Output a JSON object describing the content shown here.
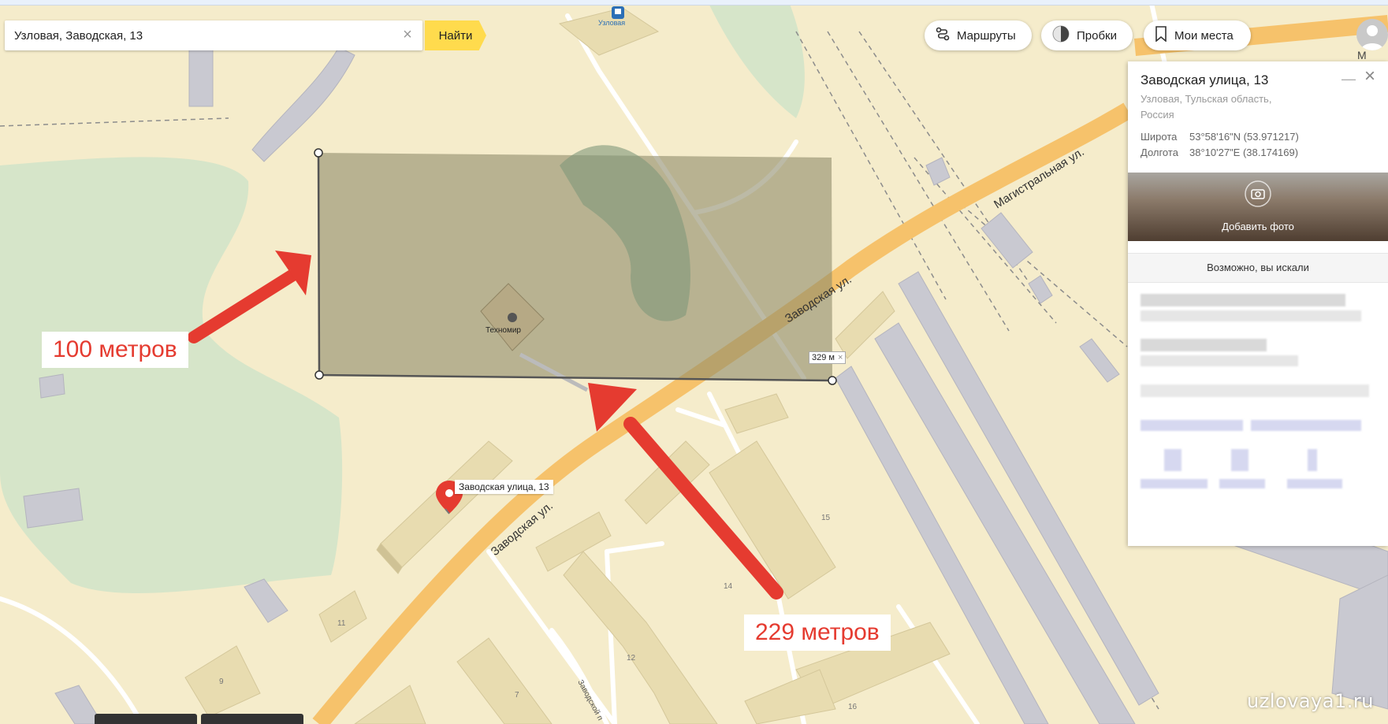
{
  "search": {
    "value": "Узловая, Заводская, 13",
    "button_label": "Найти"
  },
  "toolbar": {
    "routes_label": "Маршруты",
    "traffic_label": "Пробки",
    "places_label": "Мои места"
  },
  "card": {
    "title": "Заводская улица, 13",
    "address": "Узловая, Тульская область, Россия",
    "lat_label": "Широта",
    "lat_value": "53°58'16\"N (53.971217)",
    "lon_label": "Долгота",
    "lon_value": "38°10'27\"E (38.174169)",
    "add_photo_label": "Добавить фото",
    "maybe_label": "Возможно, вы искали"
  },
  "map": {
    "street_zavodskaya": "Заводская ул.",
    "street_zavodskaya_2": "Заводская ул.",
    "street_magistral": "Магистральная ул.",
    "street_small": "Заводской п",
    "bus_stop": "Узловая",
    "store": "Техномир",
    "pin_label": "Заводская улица, 13",
    "distance_label": "329 м",
    "house_numbers": [
      "15",
      "14",
      "12",
      "11",
      "9",
      "7",
      "16"
    ],
    "corner_letter": "М"
  },
  "annotations": {
    "left": "100 метров",
    "bottom": "229 метров"
  },
  "watermark": "uzlovaya1.ru",
  "colors": {
    "map_background": "#f5eccb",
    "road_major": "#f6c26b",
    "building": "#e8dcb0",
    "rail_building": "#c9c9d1",
    "park": "#d5e4c8",
    "measure_area": "#a19e7e",
    "annotation_arrow": "#e53b30",
    "search_button": "#ffdb4d"
  }
}
